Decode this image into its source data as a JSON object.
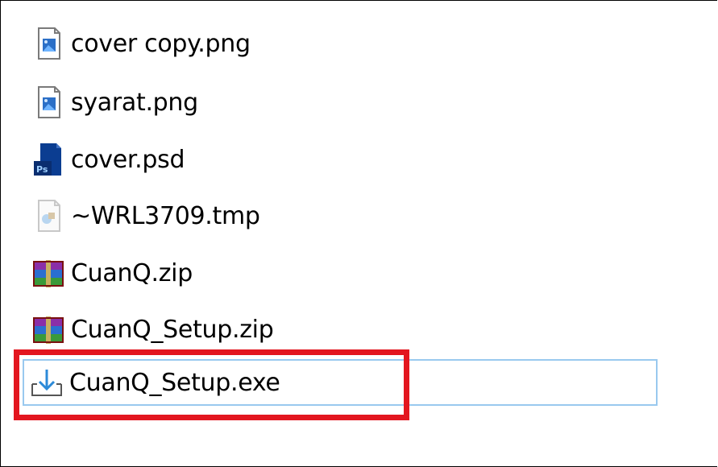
{
  "files": [
    {
      "name": "cover copy.png",
      "icon": "png-image-icon"
    },
    {
      "name": "syarat.png",
      "icon": "png-image-icon"
    },
    {
      "name": "cover.psd",
      "icon": "photoshop-icon"
    },
    {
      "name": "~WRL3709.tmp",
      "icon": "tmp-file-icon"
    },
    {
      "name": "CuanQ.zip",
      "icon": "winrar-archive-icon"
    },
    {
      "name": "CuanQ_Setup.zip",
      "icon": "winrar-archive-icon"
    },
    {
      "name": "CuanQ_Setup.exe",
      "icon": "installer-download-icon",
      "selected": true
    }
  ],
  "colors": {
    "highlight_box": "#e3161f",
    "selection_border": "#99c9ef"
  }
}
